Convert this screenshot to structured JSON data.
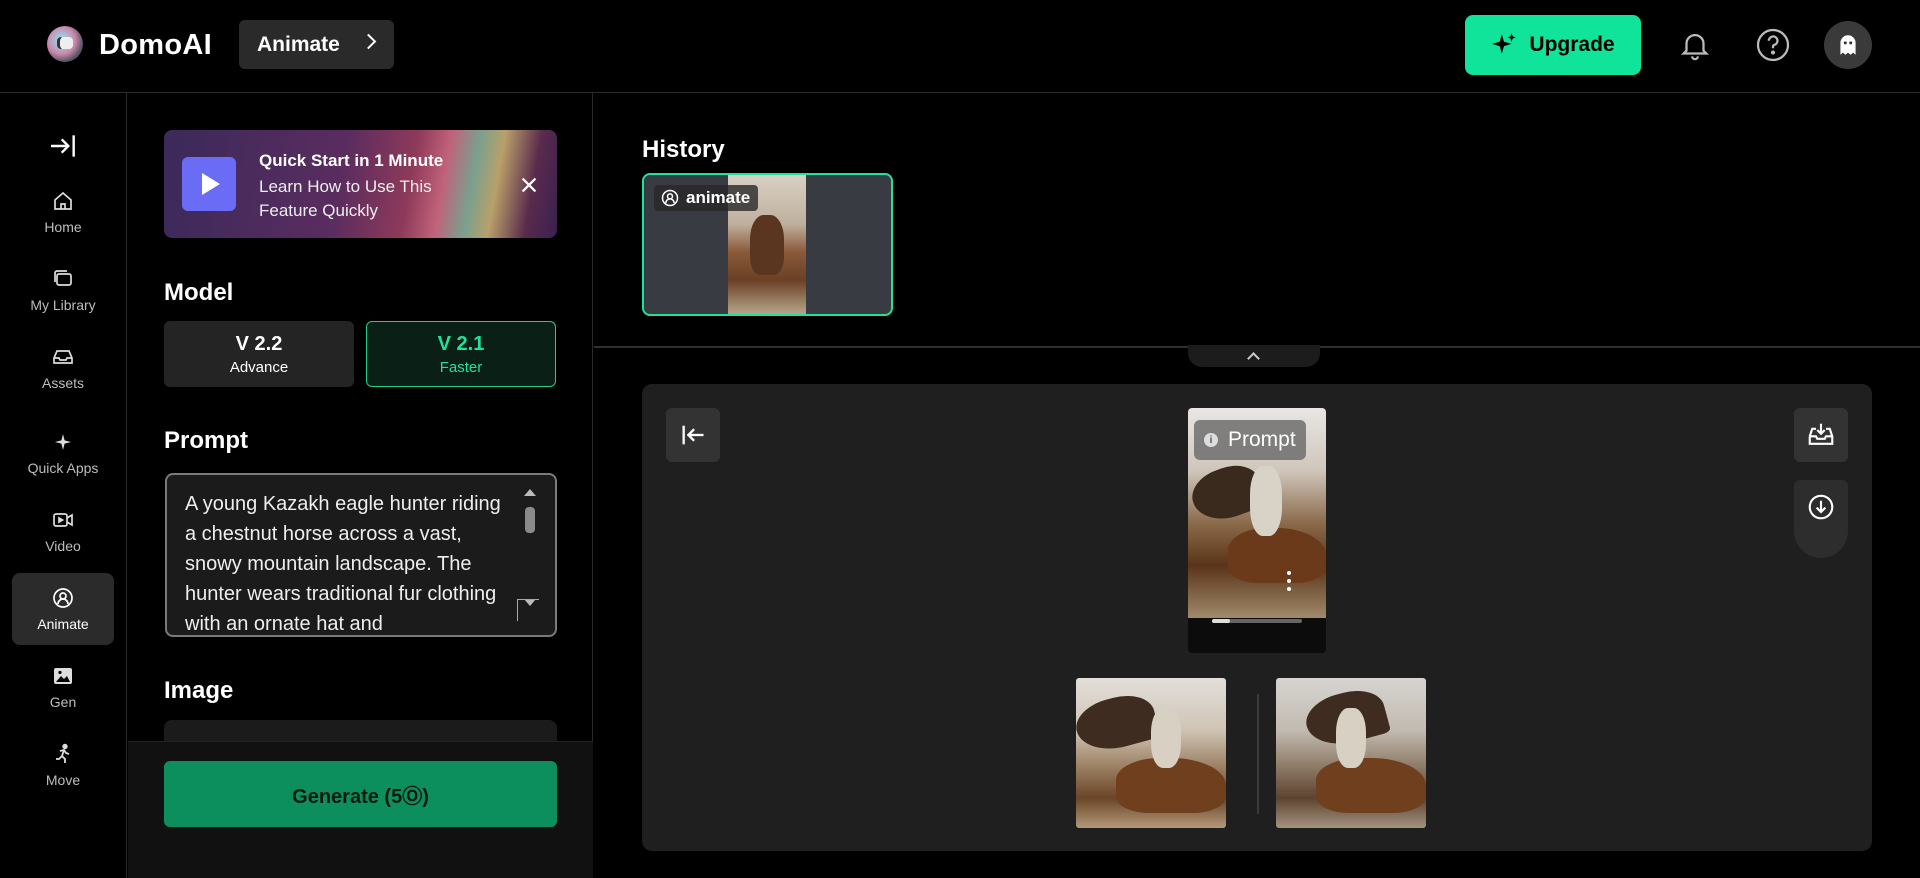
{
  "header": {
    "brand": "DomoAI",
    "breadcrumb": "Animate",
    "upgrade_label": "Upgrade",
    "accent": "#10e39a"
  },
  "sidebar": {
    "items": [
      {
        "label": "Home",
        "icon": "home-icon"
      },
      {
        "label": "My Library",
        "icon": "library-icon"
      },
      {
        "label": "Assets",
        "icon": "assets-icon"
      },
      {
        "label": "Quick Apps",
        "icon": "sparkle-icon"
      },
      {
        "label": "Video",
        "icon": "video-icon"
      },
      {
        "label": "Animate",
        "icon": "animate-icon",
        "active": true
      },
      {
        "label": "Gen",
        "icon": "image-icon"
      },
      {
        "label": "Move",
        "icon": "move-icon"
      }
    ]
  },
  "panel": {
    "banner": {
      "title": "Quick Start in 1 Minute",
      "subtitle": "Learn How to Use This Feature Quickly"
    },
    "model_title": "Model",
    "models": [
      {
        "version": "V 2.2",
        "desc": "Advance",
        "selected": false
      },
      {
        "version": "V 2.1",
        "desc": "Faster",
        "selected": true
      }
    ],
    "prompt_title": "Prompt",
    "prompt_value": "A young Kazakh eagle hunter riding a chestnut horse across a vast, snowy mountain landscape. The hunter wears traditional fur clothing with an ornate hat and",
    "image_title": "Image",
    "generate_label": "Generate (5Ⓞ)"
  },
  "main": {
    "history_title": "History",
    "history_items": [
      {
        "label": "animate"
      }
    ],
    "viewer": {
      "prompt_tag": "Prompt",
      "progress": 0.2
    }
  }
}
